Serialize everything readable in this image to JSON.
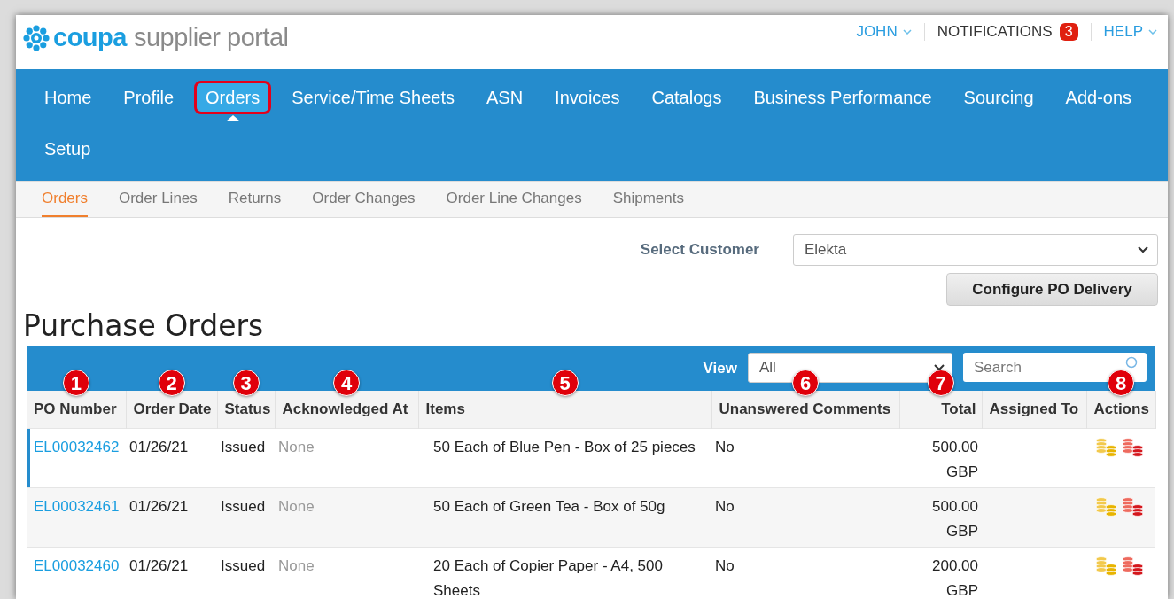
{
  "header": {
    "logo_brand": "coupa",
    "logo_product": "supplier portal",
    "user_menu": "JOHN",
    "notifications": {
      "label": "NOTIFICATIONS",
      "count": "3"
    },
    "help_menu": "HELP"
  },
  "nav": [
    {
      "label": "Home",
      "selected": false,
      "outlined": false
    },
    {
      "label": "Profile",
      "selected": false,
      "outlined": false
    },
    {
      "label": "Orders",
      "selected": true,
      "outlined": true
    },
    {
      "label": "Service/Time Sheets",
      "selected": false,
      "outlined": false
    },
    {
      "label": "ASN",
      "selected": false,
      "outlined": false
    },
    {
      "label": "Invoices",
      "selected": false,
      "outlined": false
    },
    {
      "label": "Catalogs",
      "selected": false,
      "outlined": false
    },
    {
      "label": "Business Performance",
      "selected": false,
      "outlined": false
    },
    {
      "label": "Sourcing",
      "selected": false,
      "outlined": false
    },
    {
      "label": "Add-ons",
      "selected": false,
      "outlined": false
    },
    {
      "label": "Setup",
      "selected": false,
      "outlined": false
    }
  ],
  "subtabs": [
    {
      "label": "Orders",
      "selected": true
    },
    {
      "label": "Order Lines",
      "selected": false
    },
    {
      "label": "Returns",
      "selected": false
    },
    {
      "label": "Order Changes",
      "selected": false
    },
    {
      "label": "Order Line Changes",
      "selected": false
    },
    {
      "label": "Shipments",
      "selected": false
    }
  ],
  "customer": {
    "label": "Select Customer",
    "value": "Elekta"
  },
  "configure_button": "Configure PO Delivery",
  "title": "Purchase Orders",
  "table": {
    "view_label": "View",
    "view_value": "All",
    "search": {
      "placeholder": "Search"
    },
    "columns": [
      {
        "label": "PO Number",
        "callout": "1"
      },
      {
        "label": "Order Date",
        "callout": "2"
      },
      {
        "label": "Status",
        "callout": "3"
      },
      {
        "label": "Acknowledged At",
        "callout": "4"
      },
      {
        "label": "Items",
        "callout": "5"
      },
      {
        "label": "Unanswered Comments",
        "callout": "6"
      },
      {
        "label": "Total",
        "callout": "7"
      },
      {
        "label": "Assigned To"
      },
      {
        "label": "Actions",
        "callout": "8"
      }
    ],
    "rows": [
      {
        "po": "EL00032462",
        "date": "01/26/21",
        "status": "Issued",
        "acknowledged": "None",
        "items": "50 Each of Blue Pen - Box of 25 pieces",
        "comments": "No",
        "total": "500.00 GBP",
        "highlighted": true
      },
      {
        "po": "EL00032461",
        "date": "01/26/21",
        "status": "Issued",
        "acknowledged": "None",
        "items": "50 Each of Green Tea - Box of 50g",
        "comments": "No",
        "total": "500.00 GBP",
        "highlighted": false
      },
      {
        "po": "EL00032460",
        "date": "01/26/21",
        "status": "Issued",
        "acknowledged": "None",
        "items": "20 Each of Copier Paper - A4, 500 Sheets",
        "comments": "No",
        "total": "200.00 GBP",
        "highlighted": false
      }
    ]
  }
}
